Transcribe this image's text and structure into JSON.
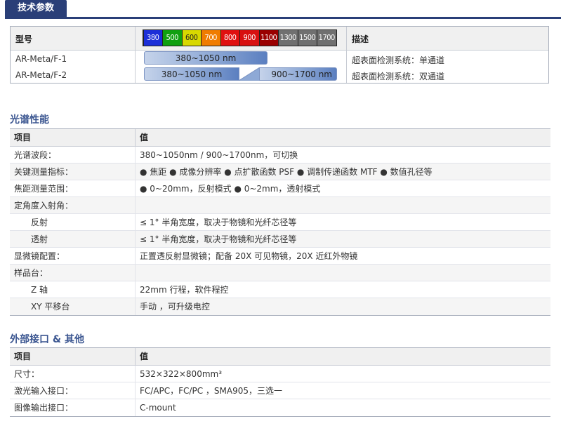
{
  "tab": {
    "title": "技术参数"
  },
  "spec_table": {
    "header_model": "型号",
    "header_desc": "描述",
    "scale_labels": [
      "380",
      "500",
      "600",
      "700",
      "800",
      "900",
      "1100",
      "1300",
      "1500",
      "1700"
    ],
    "scale_colors": [
      "#1c2fd8",
      "#10a010",
      "#d8d800",
      "#f07c00",
      "#e01010",
      "#d81010",
      "#9a0000",
      "#707070",
      "#707070",
      "#707070"
    ],
    "rows": [
      {
        "model": "AR-Meta/F-1",
        "range1": "380~1050 nm",
        "desc": "超表面检测系统：单通道"
      },
      {
        "model": "AR-Meta/F-2",
        "range1": "380~1050 nm",
        "range2": "900~1700 nm",
        "desc": "超表面检测系统：双通道"
      }
    ]
  },
  "spectral": {
    "title": "光谱性能",
    "head_item": "项目",
    "head_value": "值",
    "rows": [
      {
        "k": "光谱波段：",
        "v": "380~1050nm / 900~1700nm，可切换"
      },
      {
        "k": "关键测量指标：",
        "v": "● 焦距   ● 成像分辨率   ● 点扩散函数 PSF   ● 调制传递函数 MTF   ● 数值孔径等"
      },
      {
        "k": "焦距测量范围：",
        "v": "● 0~20mm，反射模式       ● 0~2mm，透射模式"
      },
      {
        "k": "定角度入射角：",
        "v": ""
      },
      {
        "k": "反射",
        "v": "≤ 1° 半角宽度，取决于物镜和光纤芯径等"
      },
      {
        "k": "透射",
        "v": "≤ 1° 半角宽度，取决于物镜和光纤芯径等"
      },
      {
        "k": "显微镜配置：",
        "v": "正置透反射显微镜；配备 20X 可见物镜，20X 近红外物镜"
      },
      {
        "k": "样品台：",
        "v": ""
      },
      {
        "k": "Z 轴",
        "v": "22mm 行程，软件程控"
      },
      {
        "k": "XY 平移台",
        "v": "手动 ，可升级电控"
      }
    ]
  },
  "interface": {
    "title": "外部接口 & 其他",
    "head_item": "项目",
    "head_value": "值",
    "rows": [
      {
        "k": "尺寸：",
        "v": "532×322×800mm³"
      },
      {
        "k": "激光输入接口：",
        "v": "FC/APC，FC/PC ，SMA905，三选一"
      },
      {
        "k": "图像输出接口：",
        "v": "C-mount"
      }
    ]
  }
}
